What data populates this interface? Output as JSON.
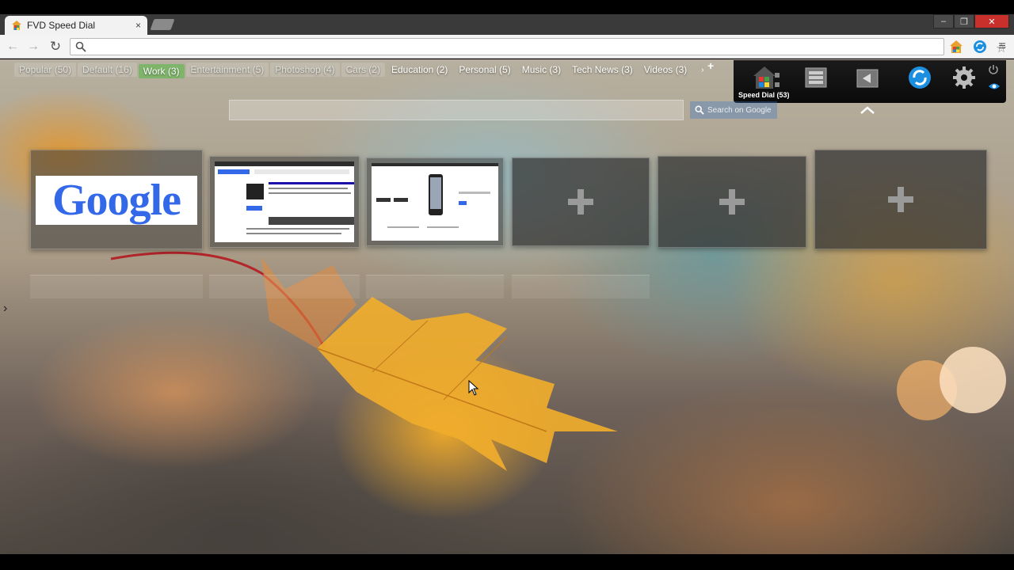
{
  "browser": {
    "tab_title": "FVD Speed Dial",
    "tab_close": "×",
    "omnibox_value": "",
    "window_controls": [
      "–",
      "❐",
      "✕"
    ]
  },
  "groups": [
    {
      "label": "Popular (50)",
      "state": "dim"
    },
    {
      "label": "Default (16)",
      "state": "dim"
    },
    {
      "label": "Work (3)",
      "state": "active"
    },
    {
      "label": "Entertainment (5)",
      "state": "dim"
    },
    {
      "label": "Photoshop (4)",
      "state": "dim"
    },
    {
      "label": "Cars (2)",
      "state": "dim"
    },
    {
      "label": "Education (2)",
      "state": "normal"
    },
    {
      "label": "Personal (5)",
      "state": "normal"
    },
    {
      "label": "Music (3)",
      "state": "normal"
    },
    {
      "label": "Tech News (3)",
      "state": "normal"
    },
    {
      "label": "Videos (3)",
      "state": "normal"
    }
  ],
  "panel": {
    "speed_dial_label": "Speed Dial (53)"
  },
  "search": {
    "placeholder": "",
    "button_label": "Search on Google"
  },
  "dials": {
    "google_logo": "Google"
  },
  "side_arrow": "›",
  "colors": {
    "active_group": "#7fb56b",
    "sync_blue": "#1d8fe0"
  }
}
